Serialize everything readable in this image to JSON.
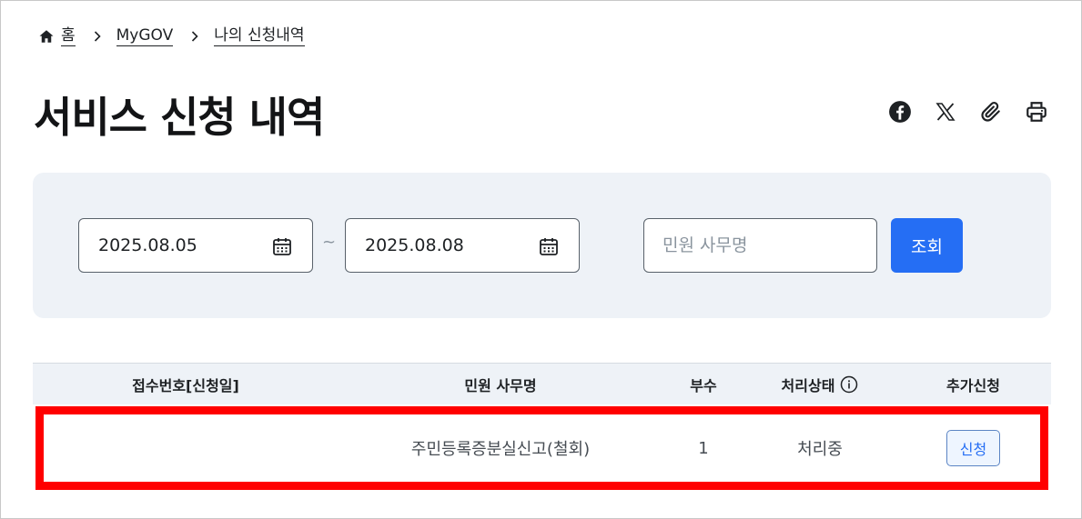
{
  "breadcrumb": {
    "home": "홈",
    "items": [
      "MyGOV",
      "나의 신청내역"
    ]
  },
  "page_title": "서비스 신청 내역",
  "share_tools": [
    "facebook-icon",
    "x-icon",
    "link-icon",
    "print-icon"
  ],
  "search": {
    "start_date": "2025.08.05",
    "separator": "~",
    "end_date": "2025.08.08",
    "keyword_placeholder": "민원 사무명",
    "keyword_value": "",
    "submit_label": "조회"
  },
  "table": {
    "headers": {
      "receipt_no": "접수번호[신청일]",
      "service_name": "민원 사무명",
      "copies": "부수",
      "status": "처리상태",
      "additional": "추가신청"
    },
    "rows": [
      {
        "receipt_no": "",
        "service_name": "주민등록증분실신고(철회)",
        "copies": "1",
        "status": "처리중",
        "action_label": "신청"
      }
    ]
  },
  "colors": {
    "primary": "#256ef4",
    "panel_bg": "#eef2f7",
    "highlight": "#ff0000"
  }
}
